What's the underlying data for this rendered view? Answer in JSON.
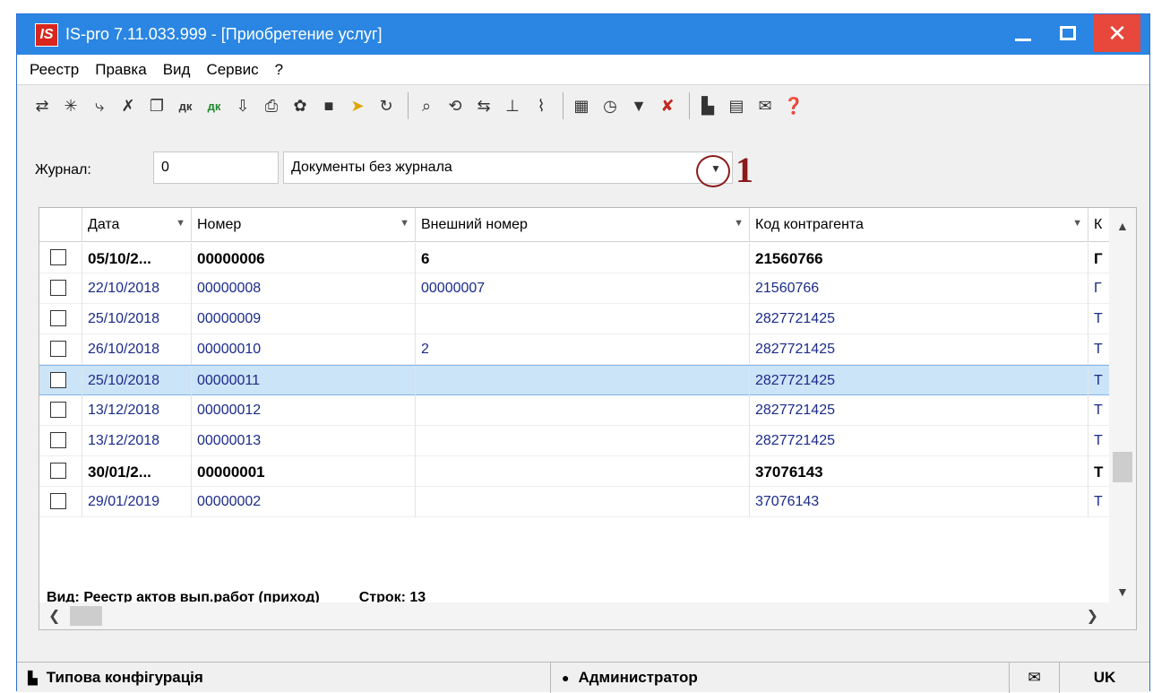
{
  "window": {
    "logo": "IS",
    "title": "IS-pro 7.11.033.999 - [Приобретение услуг]",
    "close": "✕"
  },
  "menu": [
    "Реестр",
    "Правка",
    "Вид",
    "Сервис",
    "?"
  ],
  "toolbar": {
    "groups": [
      [
        "folder-open-icon",
        "new-doc-icon",
        "new-copy-icon",
        "delete-icon",
        "copy-icon",
        "debit-credit-icon",
        "debit-credit-green-icon",
        "import-icon",
        "print-icon",
        "settings-icon",
        "dark-square-icon",
        "arrow-yellow-icon",
        "refresh-icon"
      ],
      [
        "search-icon",
        "search-next-icon",
        "find-replace-icon",
        "tree-icon",
        "attach-icon"
      ],
      [
        "grid-icon",
        "history-icon",
        "filter-icon",
        "filter-clear-icon"
      ],
      [
        "chart-icon",
        "form-icon",
        "mail-icon",
        "help-icon"
      ]
    ],
    "glyphs": {
      "folder-open-icon": "⇄",
      "new-doc-icon": "✳",
      "new-copy-icon": "⤷",
      "delete-icon": "✗",
      "copy-icon": "❐",
      "debit-credit-icon": "дк",
      "debit-credit-green-icon": "дк",
      "import-icon": "⇩",
      "print-icon": "⎙",
      "settings-icon": "✿",
      "dark-square-icon": "■",
      "arrow-yellow-icon": "➤",
      "refresh-icon": "↻",
      "search-icon": "⌕",
      "search-next-icon": "⟲",
      "find-replace-icon": "⇆",
      "tree-icon": "⊥",
      "attach-icon": "⌇",
      "grid-icon": "▦",
      "history-icon": "◷",
      "filter-icon": "▼",
      "filter-clear-icon": "✘",
      "chart-icon": "▙",
      "form-icon": "▤",
      "mail-icon": "✉",
      "help-icon": "❓"
    }
  },
  "journal": {
    "label": "Журнал:",
    "code": "0",
    "value": "Документы без журнала",
    "annotation": "1"
  },
  "grid": {
    "columns": [
      "Дата",
      "Номер",
      "Внешний номер",
      "Код контрагента",
      "К"
    ],
    "rows": [
      {
        "date": "05/10/2...",
        "num": "00000006",
        "ext": "6",
        "code": "21560766",
        "k": "Г",
        "bold": true,
        "selected": false
      },
      {
        "date": "22/10/2018",
        "num": "00000008",
        "ext": "00000007",
        "code": "21560766",
        "k": "Г",
        "bold": false,
        "selected": false
      },
      {
        "date": "25/10/2018",
        "num": "00000009",
        "ext": "",
        "code": "2827721425",
        "k": "Т",
        "bold": false,
        "selected": false
      },
      {
        "date": "26/10/2018",
        "num": "00000010",
        "ext": "2",
        "code": "2827721425",
        "k": "Т",
        "bold": false,
        "selected": false
      },
      {
        "date": "25/10/2018",
        "num": "00000011",
        "ext": "",
        "code": "2827721425",
        "k": "Т",
        "bold": false,
        "selected": true
      },
      {
        "date": "13/12/2018",
        "num": "00000012",
        "ext": "",
        "code": "2827721425",
        "k": "Т",
        "bold": false,
        "selected": false
      },
      {
        "date": "13/12/2018",
        "num": "00000013",
        "ext": "",
        "code": "2827721425",
        "k": "Т",
        "bold": false,
        "selected": false
      },
      {
        "date": "30/01/2...",
        "num": "00000001",
        "ext": "",
        "code": "37076143",
        "k": "Т",
        "bold": true,
        "selected": false
      },
      {
        "date": "29/01/2019",
        "num": "00000002",
        "ext": "",
        "code": "37076143",
        "k": "Т",
        "bold": false,
        "selected": false
      }
    ],
    "view_label": "Вид: Реестр актов вып.работ (приход)",
    "rows_label": "Строк: 13"
  },
  "statusbar": {
    "config": "Типова конфігурація",
    "user": "Администратор",
    "lang": "UK"
  },
  "colors": {
    "titlebar": "#2a86e2",
    "close": "#e8473b",
    "selected_row": "#cce4f7",
    "link_text": "#1a2a8a",
    "annotation": "#8b1a1a"
  }
}
